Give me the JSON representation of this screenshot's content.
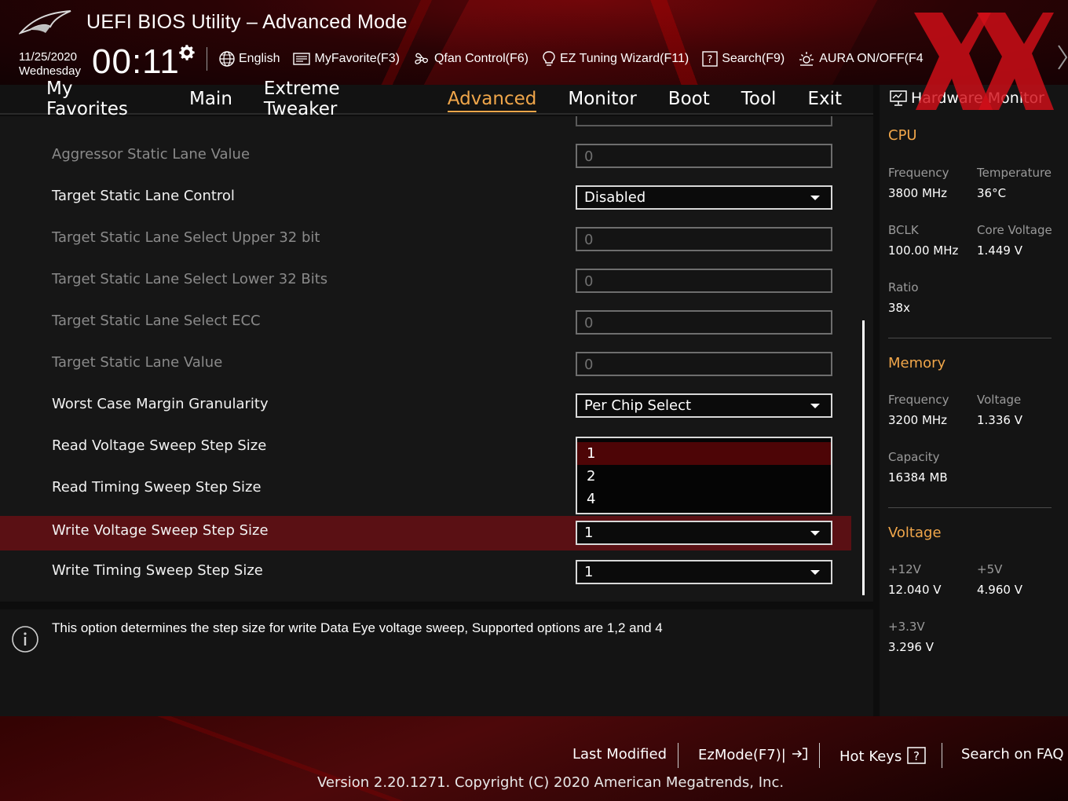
{
  "header": {
    "title": "UEFI BIOS Utility – Advanced Mode",
    "date": "11/25/2020",
    "weekday": "Wednesday",
    "time": "00:11",
    "toolbar": [
      {
        "label": "English",
        "icon": "globe-icon"
      },
      {
        "label": "MyFavorite(F3)",
        "icon": "favorite-list-icon"
      },
      {
        "label": "Qfan Control(F6)",
        "icon": "fan-icon"
      },
      {
        "label": "EZ Tuning Wizard(F11)",
        "icon": "lightbulb-icon"
      },
      {
        "label": "Search(F9)",
        "icon": "help-box-icon"
      },
      {
        "label": "AURA ON/OFF(F4",
        "icon": "aura-light-icon"
      }
    ]
  },
  "nav": {
    "tabs": [
      "My Favorites",
      "Main",
      "Extreme Tweaker",
      "Advanced",
      "Monitor",
      "Boot",
      "Tool",
      "Exit"
    ],
    "active": "Advanced"
  },
  "settings": [
    {
      "label": "Aggressor Static Lane Value",
      "type": "field",
      "value": "0",
      "enabled": false
    },
    {
      "label": "Target Static Lane Control",
      "type": "select",
      "value": "Disabled",
      "enabled": true
    },
    {
      "label": "Target Static Lane Select Upper 32 bit",
      "type": "field",
      "value": "0",
      "enabled": false
    },
    {
      "label": "Target Static Lane Select Lower 32 Bits",
      "type": "field",
      "value": "0",
      "enabled": false
    },
    {
      "label": "Target Static Lane Select ECC",
      "type": "field",
      "value": "0",
      "enabled": false
    },
    {
      "label": "Target Static Lane Value",
      "type": "field",
      "value": "0",
      "enabled": false
    },
    {
      "label": "Worst Case Margin Granularity",
      "type": "select",
      "value": "Per Chip Select",
      "enabled": true
    },
    {
      "label": "Read Voltage Sweep Step Size",
      "type": "none",
      "value": "",
      "enabled": true
    },
    {
      "label": "Read Timing Sweep Step Size",
      "type": "none",
      "value": "",
      "enabled": true
    },
    {
      "label": "Write Voltage Sweep Step Size",
      "type": "select",
      "value": "1",
      "enabled": true,
      "selected": true
    },
    {
      "label": "Write Timing Sweep Step Size",
      "type": "select",
      "value": "1",
      "enabled": true
    }
  ],
  "dropdown": {
    "options": [
      "1",
      "2",
      "4"
    ],
    "highlighted": "1"
  },
  "info": {
    "text": "This option determines the step size for write Data Eye voltage sweep, Supported options are 1,2 and 4"
  },
  "hardware_monitor": {
    "title": "Hardware Monitor",
    "cpu": {
      "heading": "CPU",
      "frequency_label": "Frequency",
      "frequency": "3800 MHz",
      "temperature_label": "Temperature",
      "temperature": "36°C",
      "bclk_label": "BCLK",
      "bclk": "100.00 MHz",
      "core_voltage_label": "Core Voltage",
      "core_voltage": "1.449 V",
      "ratio_label": "Ratio",
      "ratio": "38x"
    },
    "memory": {
      "heading": "Memory",
      "frequency_label": "Frequency",
      "frequency": "3200 MHz",
      "voltage_label": "Voltage",
      "voltage": "1.336 V",
      "capacity_label": "Capacity",
      "capacity": "16384 MB"
    },
    "voltage": {
      "heading": "Voltage",
      "v12_label": "+12V",
      "v12": "12.040 V",
      "v5_label": "+5V",
      "v5": "4.960 V",
      "v33_label": "+3.3V",
      "v33": "3.296 V"
    }
  },
  "footer": {
    "last_modified": "Last Modified",
    "ezmode": "EzMode(F7)|",
    "hot_keys": "Hot Keys",
    "search_faq": "Search on FAQ",
    "version": "Version 2.20.1271. Copyright (C) 2020 American Megatrends, Inc."
  },
  "colors": {
    "accent": "#f0a64a",
    "selected_row": "#5a1014",
    "highlight_option": "#4d0506"
  }
}
